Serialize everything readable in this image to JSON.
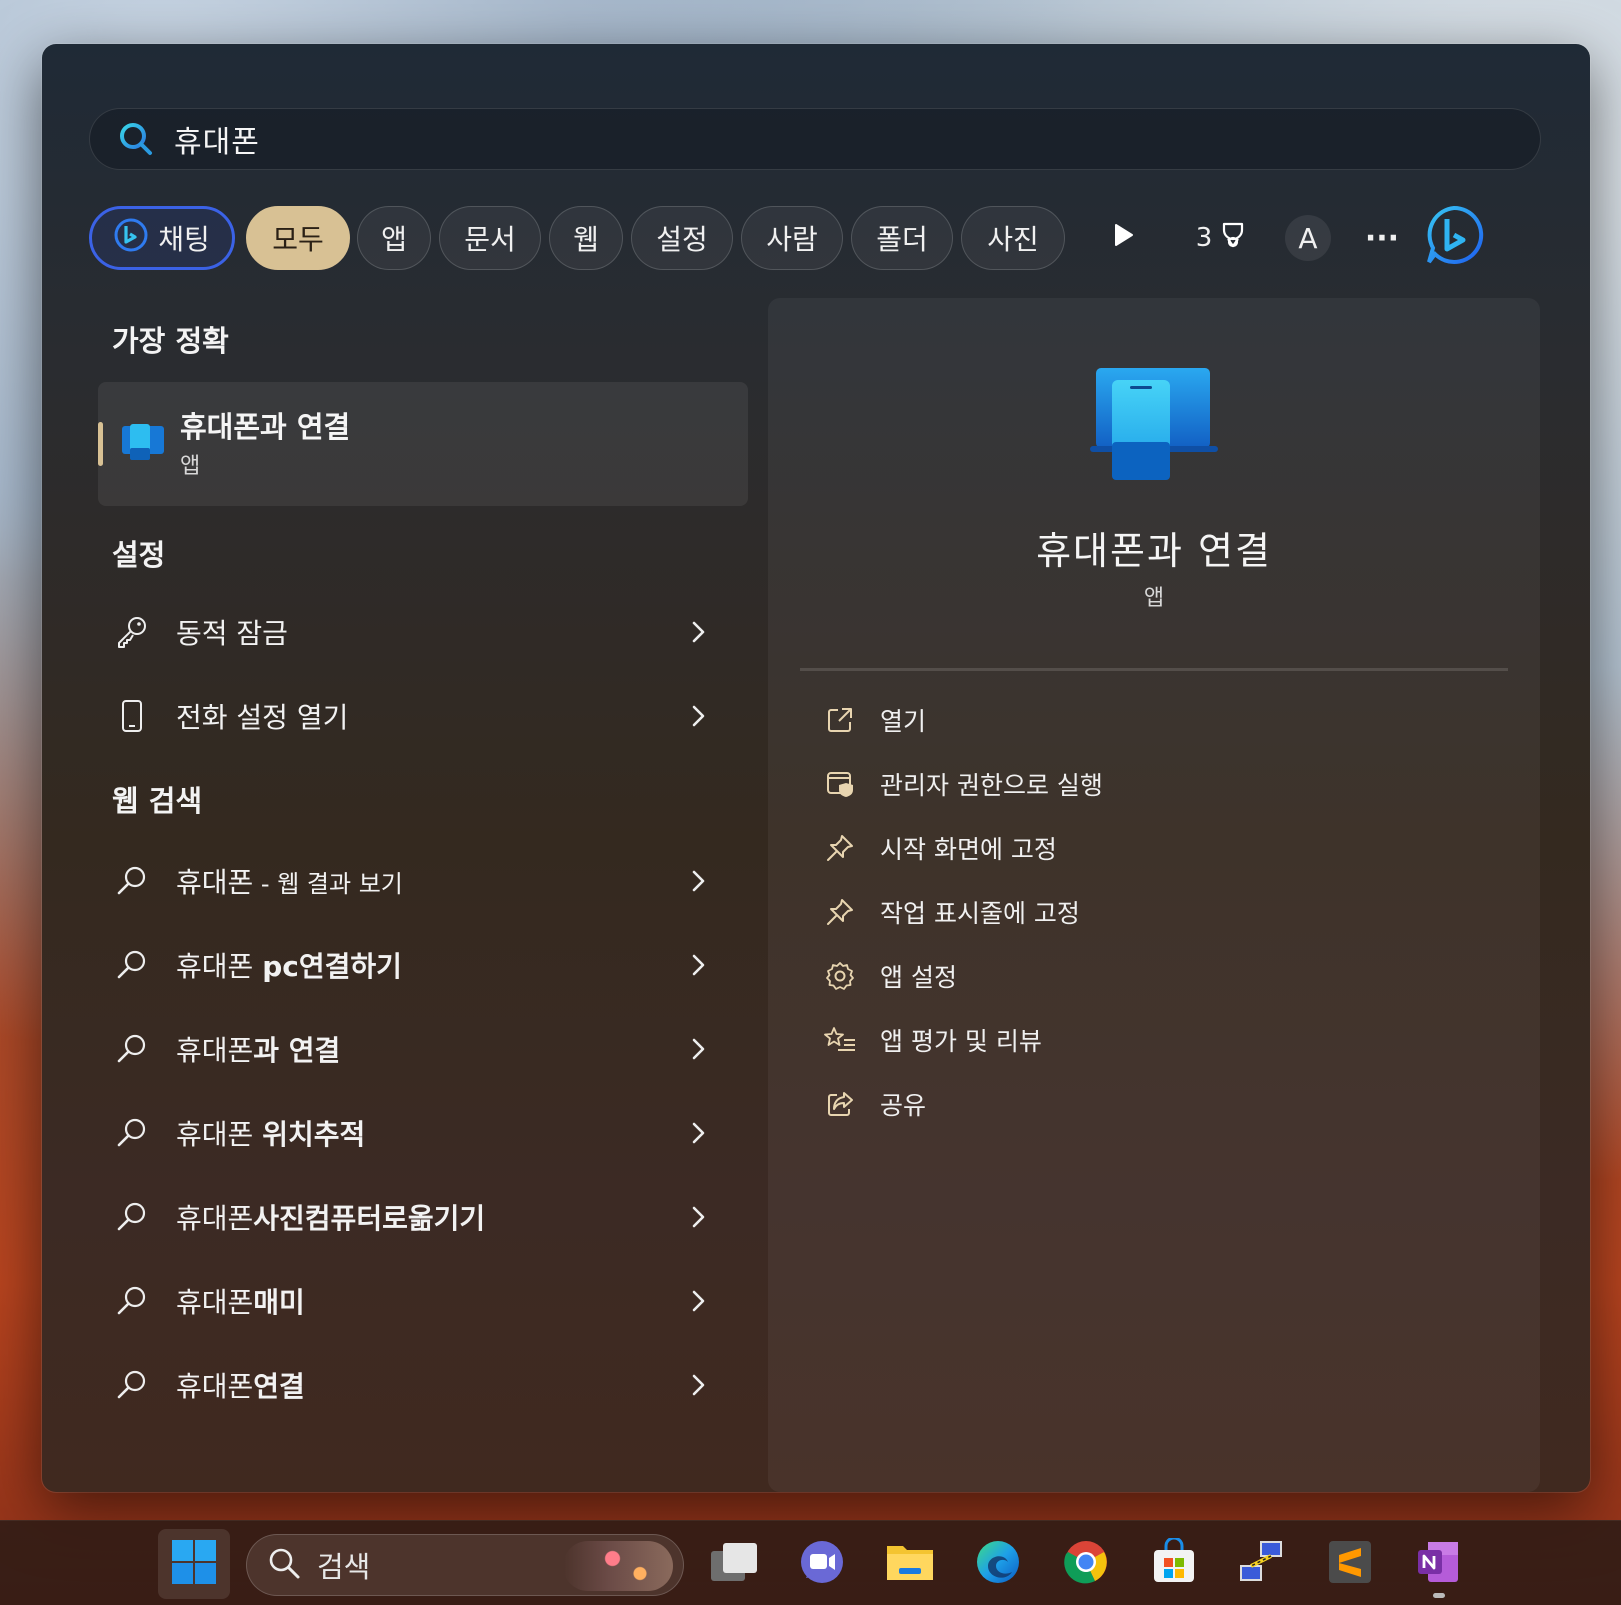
{
  "search": {
    "query": "휴대폰"
  },
  "filters": {
    "chat": "채팅",
    "chips": [
      "모두",
      "앱",
      "문서",
      "웹",
      "설정",
      "사람",
      "폴더",
      "사진"
    ],
    "score": "3",
    "account_initial": "A",
    "more": "···"
  },
  "best_match": {
    "section_title": "가장 정확",
    "title": "휴대폰과 연결",
    "subtitle": "앱"
  },
  "settings": {
    "section_title": "설정",
    "items": [
      {
        "label": "동적 잠금",
        "icon": "key-icon"
      },
      {
        "label": "전화 설정 열기",
        "icon": "phone-icon"
      }
    ]
  },
  "web": {
    "section_title": "웹 검색",
    "items": [
      {
        "prefix": "휴대폰",
        "bold": "",
        "suffix": " - 웹 결과 보기"
      },
      {
        "prefix": "휴대폰 ",
        "bold": "pc연결하기",
        "suffix": ""
      },
      {
        "prefix": "휴대폰",
        "bold": "과 연결",
        "suffix": ""
      },
      {
        "prefix": "휴대폰 ",
        "bold": "위치추적",
        "suffix": ""
      },
      {
        "prefix": "휴대폰",
        "bold": "사진컴퓨터로옮기기",
        "suffix": ""
      },
      {
        "prefix": "휴대폰",
        "bold": "매미",
        "suffix": ""
      },
      {
        "prefix": "휴대폰",
        "bold": "연결",
        "suffix": ""
      }
    ]
  },
  "detail": {
    "title": "휴대폰과 연결",
    "subtitle": "앱",
    "actions": [
      {
        "label": "열기",
        "icon": "open-external-icon"
      },
      {
        "label": "관리자 권한으로 실행",
        "icon": "admin-shield-icon"
      },
      {
        "label": "시작 화면에 고정",
        "icon": "pin-icon"
      },
      {
        "label": "작업 표시줄에 고정",
        "icon": "pin-icon"
      },
      {
        "label": "앱 설정",
        "icon": "gear-icon"
      },
      {
        "label": "앱 평가 및 리뷰",
        "icon": "star-list-icon"
      },
      {
        "label": "공유",
        "icon": "share-icon"
      }
    ]
  },
  "taskbar": {
    "search_label": "검색",
    "apps": [
      "windows-start-icon",
      "task-view-icon",
      "teams-icon",
      "file-explorer-icon",
      "edge-icon",
      "chrome-icon",
      "microsoft-store-icon",
      "network-icon",
      "sublime-text-icon",
      "onenote-icon"
    ]
  },
  "colors": {
    "accent_chip": "#d8c194",
    "chat_border": "#3b62e6",
    "bing_blue": "#1e8bff"
  }
}
